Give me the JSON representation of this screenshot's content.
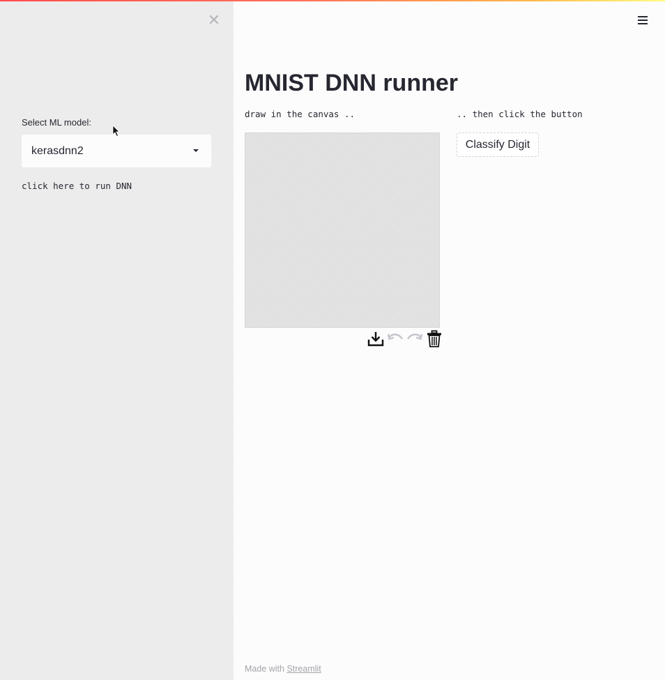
{
  "sidebar": {
    "close_icon": "close-icon",
    "select_label": "Select ML model:",
    "select_value": "kerasdnn2",
    "note": "click here to run DNN"
  },
  "header": {
    "menu_icon": "hamburger-menu-icon"
  },
  "main": {
    "title": "MNIST DNN runner",
    "canvas_hint": "draw in the canvas ..",
    "button_hint": ".. then click the button",
    "classify_label": "Classify Digit",
    "canvas_tools": [
      "download-icon",
      "undo-icon",
      "redo-icon",
      "trash-icon"
    ]
  },
  "footer": {
    "prefix": "Made with ",
    "link": "Streamlit"
  },
  "colors": {
    "accent_gradient": [
      "#ff4b4b",
      "#fdb84b",
      "#fffd80"
    ],
    "text": "#262730",
    "muted": "#a3a4aa"
  }
}
